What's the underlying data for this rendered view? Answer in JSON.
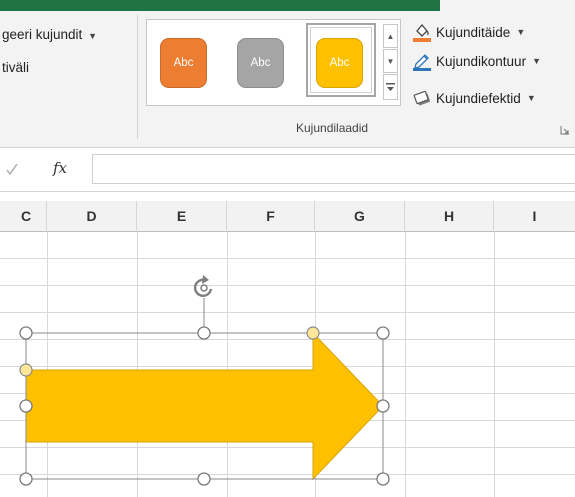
{
  "ribbon": {
    "left_group": {
      "item1_label": "geeri kujundit",
      "item2_label": "tiväli"
    },
    "shape_styles": {
      "group_label": "Kujundilaadid",
      "styles": [
        {
          "label": "Abc",
          "color": "#ED7D31"
        },
        {
          "label": "Abc",
          "color": "#A5A5A5"
        },
        {
          "label": "Abc",
          "color": "#FFC000"
        }
      ],
      "commands": [
        {
          "label": "Kujunditäide"
        },
        {
          "label": "Kujundikontuur"
        },
        {
          "label": "Kujundiefektid"
        }
      ]
    },
    "accent_color": "#217346"
  },
  "formula_bar": {
    "fx_label": "fx",
    "value": ""
  },
  "sheet": {
    "columns": [
      "C",
      "D",
      "E",
      "F",
      "G",
      "H",
      "I"
    ],
    "shape": {
      "type": "right-arrow",
      "fill_color": "#FFC000",
      "outline_color": "#D9A300",
      "selected": true
    }
  }
}
